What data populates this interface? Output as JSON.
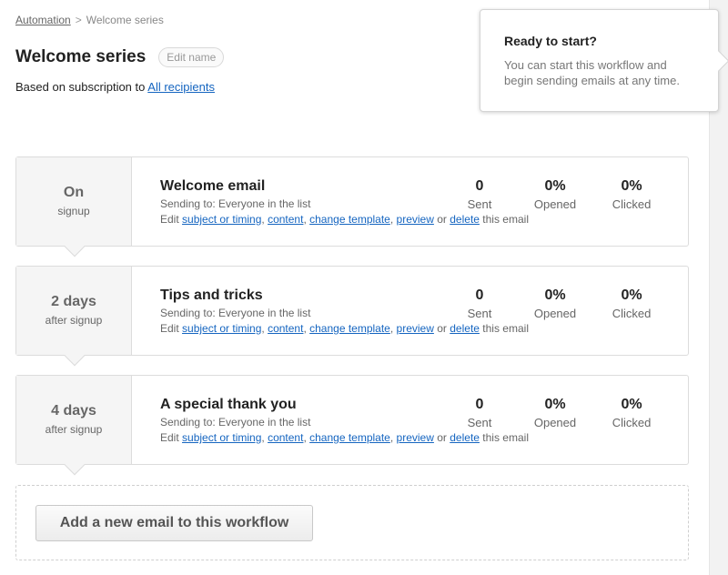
{
  "breadcrumb": {
    "parent": "Automation",
    "separator": ">",
    "current": "Welcome series"
  },
  "header": {
    "title": "Welcome series",
    "edit_name_label": "Edit name"
  },
  "subtitle": {
    "prefix": "Based on subscription to",
    "link": "All recipients"
  },
  "popover": {
    "title": "Ready to start?",
    "body": "You can start this workflow and begin sending emails at any time."
  },
  "common": {
    "edit_prefix": "Edit",
    "link_subject": "subject or timing",
    "link_content": "content",
    "link_template": "change template",
    "link_preview": "preview",
    "word_or": "or",
    "link_delete": "delete",
    "suffix": "this email",
    "sent_label": "Sent",
    "opened_label": "Opened",
    "clicked_label": "Clicked"
  },
  "emails": [
    {
      "timing_big": "On",
      "timing_small": "signup",
      "name": "Welcome email",
      "sending": "Sending to: Everyone in the list",
      "sent": "0",
      "opened": "0%",
      "clicked": "0%"
    },
    {
      "timing_big": "2 days",
      "timing_small": "after signup",
      "name": "Tips and tricks",
      "sending": "Sending to: Everyone in the list",
      "sent": "0",
      "opened": "0%",
      "clicked": "0%"
    },
    {
      "timing_big": "4 days",
      "timing_small": "after signup",
      "name": "A special thank you",
      "sending": "Sending to: Everyone in the list",
      "sent": "0",
      "opened": "0%",
      "clicked": "0%"
    }
  ],
  "add_button_label": "Add a new email to this workflow"
}
